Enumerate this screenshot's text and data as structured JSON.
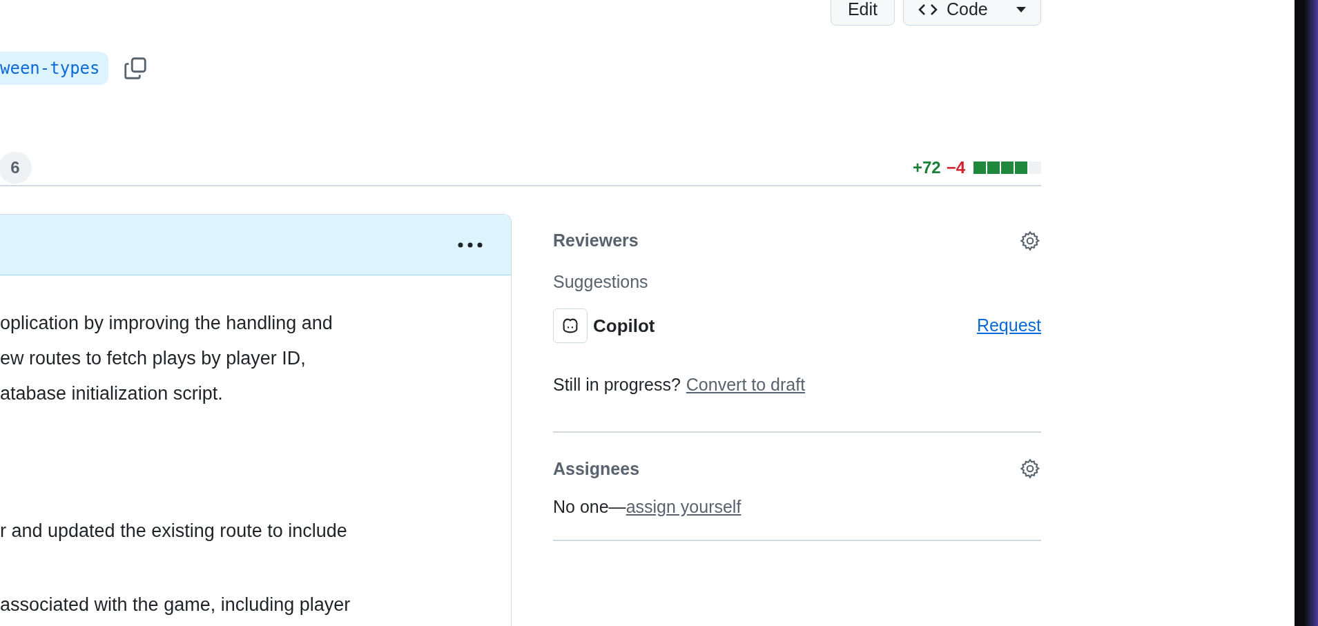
{
  "header_actions": [
    {
      "kind": "edit",
      "label": "Edit"
    },
    {
      "kind": "code",
      "label": "Code"
    }
  ],
  "branch": {
    "name": "ween-types"
  },
  "tab_counter": "6",
  "diffstat": {
    "additions": "+72",
    "deletions": "−4",
    "level": 0.8
  },
  "description": {
    "paragraphs": [
      "oplication by improving the handling and",
      "ew routes to fetch plays by player ID,",
      "atabase initialization script.",
      "r and updated the existing route to include",
      "associated with the game, including player"
    ]
  },
  "sidebar": {
    "reviewers": {
      "title": "Reviewers",
      "suggestions_label": "Suggestions",
      "suggestions": [
        {
          "name": "Copilot",
          "action": "Request"
        }
      ],
      "draft_prompt": "Still in progress?",
      "draft_link": "Convert to draft"
    },
    "assignees": {
      "title": "Assignees",
      "empty_text": "No one—",
      "assign_link": "assign yourself"
    }
  }
}
